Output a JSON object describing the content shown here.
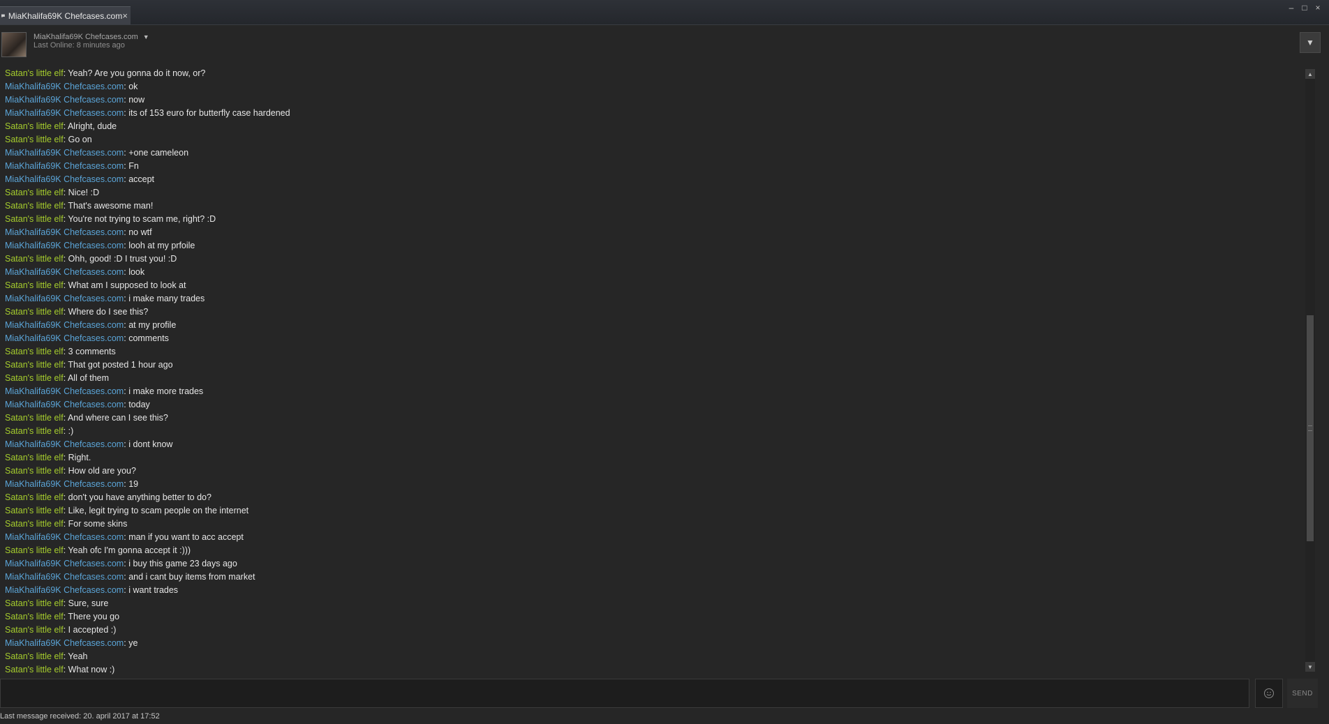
{
  "tab": {
    "label": "MiaKhalifa69K Chefcases.com",
    "close": "×"
  },
  "window_controls": {
    "minimize": "–",
    "maximize": "□",
    "close": "×"
  },
  "header": {
    "name": "MiaKhalifa69K Chefcases.com",
    "status": "Last Online: 8 minutes ago",
    "dropdown_icon": "chevron-down-icon"
  },
  "senders": {
    "s1": "Satan's little elf",
    "s2": "MiaKhalifa69K Chefcases.com"
  },
  "colors": {
    "self": "#a5cc2d",
    "friend": "#5ba5d8",
    "background": "#262626"
  },
  "messages": [
    {
      "from": "s1",
      "text": "Yeah? Are you gonna do it now, or?"
    },
    {
      "from": "s2",
      "text": "ok"
    },
    {
      "from": "s2",
      "text": "now"
    },
    {
      "from": "s2",
      "text": "its of 153 euro for butterfly case hardened"
    },
    {
      "from": "s1",
      "text": "Alright, dude"
    },
    {
      "from": "s1",
      "text": "Go on"
    },
    {
      "from": "s2",
      "text": "+one cameleon"
    },
    {
      "from": "s2",
      "text": "Fn"
    },
    {
      "from": "s2",
      "text": "accept"
    },
    {
      "from": "s1",
      "text": "Nice! :D"
    },
    {
      "from": "s1",
      "text": "That's awesome man!"
    },
    {
      "from": "s1",
      "text": "You're not trying to scam me, right? :D"
    },
    {
      "from": "s2",
      "text": "no wtf"
    },
    {
      "from": "s2",
      "text": "looh at my prfoile"
    },
    {
      "from": "s1",
      "text": "Ohh, good! :D I trust you! :D"
    },
    {
      "from": "s2",
      "text": "look"
    },
    {
      "from": "s1",
      "text": "What am I supposed to look at"
    },
    {
      "from": "s2",
      "text": "i make many trades"
    },
    {
      "from": "s1",
      "text": "Where do I see this?"
    },
    {
      "from": "s2",
      "text": "at my profile"
    },
    {
      "from": "s2",
      "text": "comments"
    },
    {
      "from": "s1",
      "text": "3 comments"
    },
    {
      "from": "s1",
      "text": "That got posted 1 hour ago"
    },
    {
      "from": "s1",
      "text": "All of them"
    },
    {
      "from": "s2",
      "text": "i make more trades"
    },
    {
      "from": "s2",
      "text": "today"
    },
    {
      "from": "s1",
      "text": "And where can I see this?"
    },
    {
      "from": "s1",
      "text": ":)"
    },
    {
      "from": "s2",
      "text": "i dont know"
    },
    {
      "from": "s1",
      "text": "Right."
    },
    {
      "from": "s1",
      "text": "How old are you?"
    },
    {
      "from": "s2",
      "text": "19"
    },
    {
      "from": "s1",
      "text": "don't you have anything better to do?"
    },
    {
      "from": "s1",
      "text": "Like, legit trying to scam people on the internet"
    },
    {
      "from": "s1",
      "text": "For some skins"
    },
    {
      "from": "s2",
      "text": "man if you want to acc accept"
    },
    {
      "from": "s1",
      "text": "Yeah ofc I'm gonna accept it :)))"
    },
    {
      "from": "s2",
      "text": "i buy this game 23 days ago"
    },
    {
      "from": "s2",
      "text": "and i cant buy items from market"
    },
    {
      "from": "s2",
      "text": "i want trades"
    },
    {
      "from": "s1",
      "text": "Sure, sure"
    },
    {
      "from": "s1",
      "text": "There you go"
    },
    {
      "from": "s1",
      "text": "I accepted :)"
    },
    {
      "from": "s2",
      "text": "ye"
    },
    {
      "from": "s1",
      "text": "Yeah"
    },
    {
      "from": "s1",
      "text": "What now :)"
    }
  ],
  "input": {
    "value": "",
    "placeholder": ""
  },
  "send_label": "SEND",
  "emoticon_icon": "smiley-icon",
  "footer": "Last message received: 20. april 2017 at 17:52"
}
